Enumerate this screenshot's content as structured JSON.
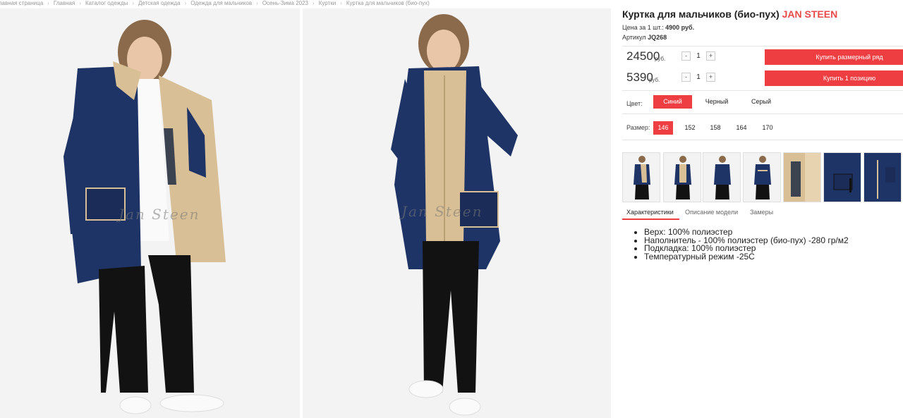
{
  "breadcrumb": [
    "Главная страница",
    "Главная",
    "Каталог одежды",
    "Детская одежда",
    "Одежда для мальчиков",
    "Осень-Зима 2023",
    "Куртки",
    "Куртка для мальчиков (био-пух)"
  ],
  "product": {
    "title": "Куртка для мальчиков (био-пух)",
    "brand": "JAN STEEN",
    "unit_price_label": "Цена за 1 шт.:",
    "unit_price_value": "4900 руб.",
    "article_label": "Артикул",
    "article_value": "JQ268",
    "watermark": "Jan Steen"
  },
  "prices": [
    {
      "value": "24500",
      "currency": "руб.",
      "qty": "1",
      "minus": "-",
      "plus": "+",
      "button": "Купить размерный ряд"
    },
    {
      "value": "5390",
      "currency": "руб.",
      "qty": "1",
      "minus": "-",
      "plus": "+",
      "button": "Купить 1 позицию"
    }
  ],
  "color": {
    "label": "Цвет:",
    "options": [
      "Синий",
      "Черный",
      "Серый"
    ],
    "selected": "Синий"
  },
  "size": {
    "label": "Размер:",
    "options": [
      "146",
      "152",
      "158",
      "164",
      "170"
    ],
    "selected": "146"
  },
  "tabs": [
    "Характеристики",
    "Описание модели",
    "Замеры"
  ],
  "specs": [
    "Верх: 100% полиэстер",
    "Наполнитель - 100% полиэстер (био-пух) -280 гр/м2",
    "Подкладка: 100% полиэстер",
    "Температурный режим -25С"
  ],
  "colors": {
    "accent": "#ef3e42",
    "brand": "#e84a4a",
    "jacket": "#1f3466",
    "lining": "#d9bf95"
  }
}
